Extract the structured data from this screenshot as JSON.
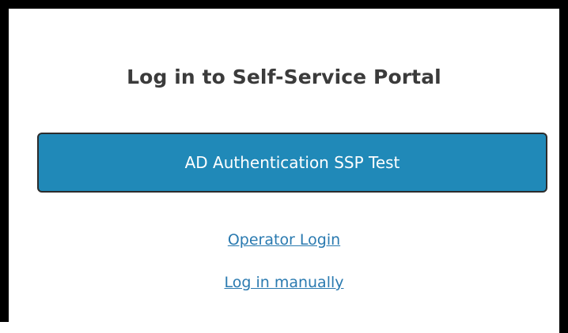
{
  "login": {
    "title": "Log in to Self-Service Portal",
    "auth_button_label": "AD Authentication SSP Test",
    "operator_login_label": "Operator Login",
    "manual_login_label": "Log in manually"
  },
  "colors": {
    "button_background": "#2089b8",
    "link": "#2a7ab0",
    "title": "#3b3b3b"
  }
}
